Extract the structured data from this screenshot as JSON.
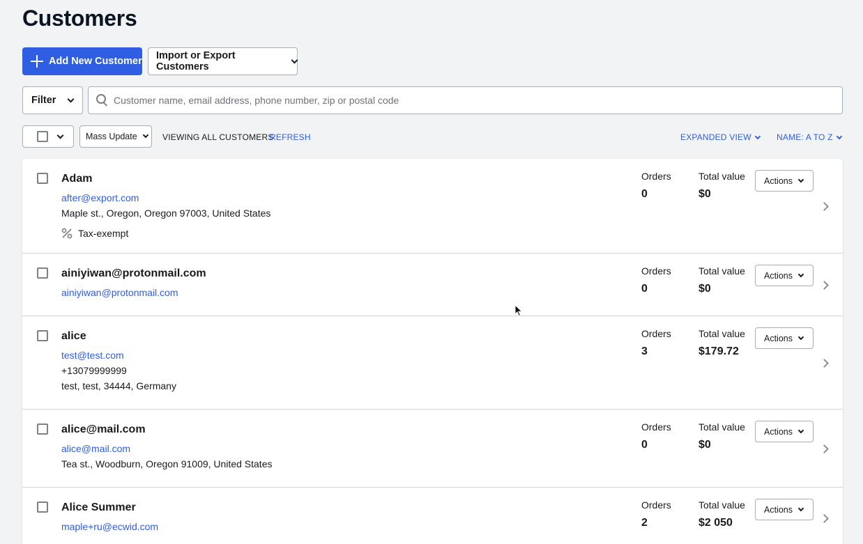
{
  "page": {
    "title": "Customers"
  },
  "toolbar": {
    "add_label": "Add New Customer",
    "import_label": "Import or Export Customers",
    "filter_label": "Filter",
    "search_placeholder": "Customer name, email address, phone number, zip or postal code",
    "mass_update_label": "Mass Update",
    "viewing_text": "VIEWING ALL CUSTOMERS",
    "refresh_label": "REFRESH",
    "view_mode_label": "EXPANDED VIEW",
    "sort_label": "NAME: A TO Z"
  },
  "labels": {
    "orders": "Orders",
    "total_value": "Total value",
    "actions": "Actions"
  },
  "icons": {
    "add": "plus-icon",
    "dropdown": "chevron-down-icon",
    "search": "search-icon",
    "tax": "percent-icon",
    "open_row": "chevron-right-icon",
    "pointer": "mouse-cursor-icon"
  },
  "colors": {
    "accent": "#2f5ee3",
    "background": "#f2f3f5",
    "title": "#0c1523"
  },
  "customers": [
    {
      "name": "Adam",
      "email": "after@export.com",
      "address": "Maple st., Oregon, Oregon 97003, United States",
      "tag": "Tax-exempt",
      "orders": "0",
      "total": "$0"
    },
    {
      "name": "ainiyiwan@protonmail.com",
      "email": "ainiyiwan@protonmail.com",
      "orders": "0",
      "total": "$0"
    },
    {
      "name": "alice",
      "email": "test@test.com",
      "phone": "+13079999999",
      "address": "test, test, 34444, Germany",
      "orders": "3",
      "total": "$179.72"
    },
    {
      "name": "alice@mail.com",
      "email": "alice@mail.com",
      "address": "Tea st., Woodburn, Oregon 91009, United States",
      "orders": "0",
      "total": "$0"
    },
    {
      "name": "Alice Summer",
      "email": "maple+ru@ecwid.com",
      "orders": "2",
      "total": "$2 050"
    }
  ]
}
